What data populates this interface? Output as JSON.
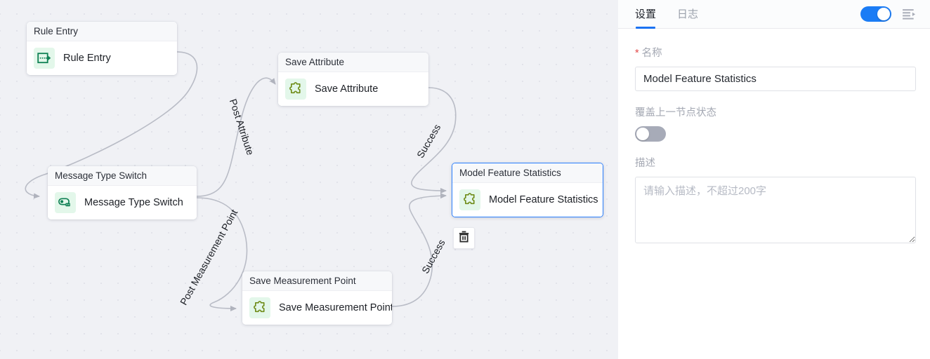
{
  "canvas": {
    "nodes": [
      {
        "id": "rule-entry",
        "header": "Rule Entry",
        "label": "Rule Entry",
        "icon": "rule-entry-icon",
        "selected": false
      },
      {
        "id": "msg-switch",
        "header": "Message Type Switch",
        "label": "Message Type Switch",
        "icon": "message-switch-icon",
        "selected": false
      },
      {
        "id": "save-attr",
        "header": "Save Attribute",
        "label": "Save Attribute",
        "icon": "puzzle-icon",
        "selected": false
      },
      {
        "id": "save-mp",
        "header": "Save Measurement Point",
        "label": "Save Measurement Point",
        "icon": "puzzle-icon",
        "selected": false
      },
      {
        "id": "model-feat",
        "header": "Model Feature Statistics",
        "label": "Model Feature Statistics",
        "icon": "puzzle-icon",
        "selected": true
      }
    ],
    "edge_labels": {
      "post_attribute": "Post Attribute",
      "post_measurement_point": "Post Measurement Point",
      "success_1": "Success",
      "success_2": "Success"
    },
    "delete_button": {
      "icon": "trash-icon",
      "title": "Delete"
    },
    "colors": {
      "background": "#f0f1f5",
      "dot": "#e2e3ea",
      "edge": "#b9bcc6",
      "selected_border": "#2a7fff",
      "icon_bg": "#e3f7ea",
      "icon_green": "#0f8054",
      "icon_olive": "#6f8c19"
    }
  },
  "panel": {
    "tabs": [
      {
        "id": "settings",
        "label": "设置",
        "active": true
      },
      {
        "id": "logs",
        "label": "日志",
        "active": false
      }
    ],
    "header_toggle": {
      "state": "on",
      "color": "#1b7cf5"
    },
    "fold_icon": "menu-fold-icon",
    "fields": {
      "name": {
        "required_mark": "*",
        "label": "名称",
        "value": "Model Feature Statistics",
        "placeholder": ""
      },
      "override": {
        "label": "覆盖上一节点状态",
        "state": "off"
      },
      "description": {
        "label": "描述",
        "value": "",
        "placeholder": "请输入描述，不超过200字"
      }
    }
  }
}
